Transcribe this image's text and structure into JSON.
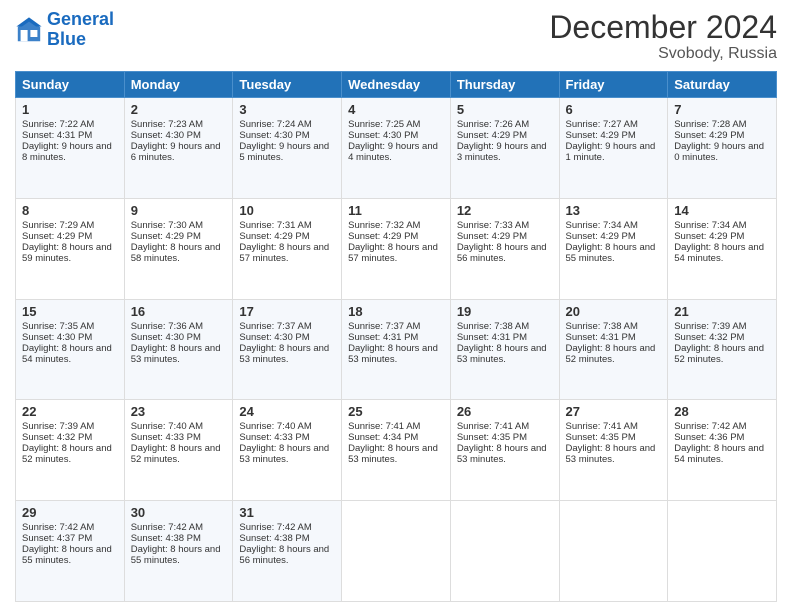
{
  "header": {
    "logo_line1": "General",
    "logo_line2": "Blue",
    "title": "December 2024",
    "subtitle": "Svobody, Russia"
  },
  "weekdays": [
    "Sunday",
    "Monday",
    "Tuesday",
    "Wednesday",
    "Thursday",
    "Friday",
    "Saturday"
  ],
  "weeks": [
    [
      {
        "day": "1",
        "sunrise": "Sunrise: 7:22 AM",
        "sunset": "Sunset: 4:31 PM",
        "daylight": "Daylight: 9 hours and 8 minutes."
      },
      {
        "day": "2",
        "sunrise": "Sunrise: 7:23 AM",
        "sunset": "Sunset: 4:30 PM",
        "daylight": "Daylight: 9 hours and 6 minutes."
      },
      {
        "day": "3",
        "sunrise": "Sunrise: 7:24 AM",
        "sunset": "Sunset: 4:30 PM",
        "daylight": "Daylight: 9 hours and 5 minutes."
      },
      {
        "day": "4",
        "sunrise": "Sunrise: 7:25 AM",
        "sunset": "Sunset: 4:30 PM",
        "daylight": "Daylight: 9 hours and 4 minutes."
      },
      {
        "day": "5",
        "sunrise": "Sunrise: 7:26 AM",
        "sunset": "Sunset: 4:29 PM",
        "daylight": "Daylight: 9 hours and 3 minutes."
      },
      {
        "day": "6",
        "sunrise": "Sunrise: 7:27 AM",
        "sunset": "Sunset: 4:29 PM",
        "daylight": "Daylight: 9 hours and 1 minute."
      },
      {
        "day": "7",
        "sunrise": "Sunrise: 7:28 AM",
        "sunset": "Sunset: 4:29 PM",
        "daylight": "Daylight: 9 hours and 0 minutes."
      }
    ],
    [
      {
        "day": "8",
        "sunrise": "Sunrise: 7:29 AM",
        "sunset": "Sunset: 4:29 PM",
        "daylight": "Daylight: 8 hours and 59 minutes."
      },
      {
        "day": "9",
        "sunrise": "Sunrise: 7:30 AM",
        "sunset": "Sunset: 4:29 PM",
        "daylight": "Daylight: 8 hours and 58 minutes."
      },
      {
        "day": "10",
        "sunrise": "Sunrise: 7:31 AM",
        "sunset": "Sunset: 4:29 PM",
        "daylight": "Daylight: 8 hours and 57 minutes."
      },
      {
        "day": "11",
        "sunrise": "Sunrise: 7:32 AM",
        "sunset": "Sunset: 4:29 PM",
        "daylight": "Daylight: 8 hours and 57 minutes."
      },
      {
        "day": "12",
        "sunrise": "Sunrise: 7:33 AM",
        "sunset": "Sunset: 4:29 PM",
        "daylight": "Daylight: 8 hours and 56 minutes."
      },
      {
        "day": "13",
        "sunrise": "Sunrise: 7:34 AM",
        "sunset": "Sunset: 4:29 PM",
        "daylight": "Daylight: 8 hours and 55 minutes."
      },
      {
        "day": "14",
        "sunrise": "Sunrise: 7:34 AM",
        "sunset": "Sunset: 4:29 PM",
        "daylight": "Daylight: 8 hours and 54 minutes."
      }
    ],
    [
      {
        "day": "15",
        "sunrise": "Sunrise: 7:35 AM",
        "sunset": "Sunset: 4:30 PM",
        "daylight": "Daylight: 8 hours and 54 minutes."
      },
      {
        "day": "16",
        "sunrise": "Sunrise: 7:36 AM",
        "sunset": "Sunset: 4:30 PM",
        "daylight": "Daylight: 8 hours and 53 minutes."
      },
      {
        "day": "17",
        "sunrise": "Sunrise: 7:37 AM",
        "sunset": "Sunset: 4:30 PM",
        "daylight": "Daylight: 8 hours and 53 minutes."
      },
      {
        "day": "18",
        "sunrise": "Sunrise: 7:37 AM",
        "sunset": "Sunset: 4:31 PM",
        "daylight": "Daylight: 8 hours and 53 minutes."
      },
      {
        "day": "19",
        "sunrise": "Sunrise: 7:38 AM",
        "sunset": "Sunset: 4:31 PM",
        "daylight": "Daylight: 8 hours and 53 minutes."
      },
      {
        "day": "20",
        "sunrise": "Sunrise: 7:38 AM",
        "sunset": "Sunset: 4:31 PM",
        "daylight": "Daylight: 8 hours and 52 minutes."
      },
      {
        "day": "21",
        "sunrise": "Sunrise: 7:39 AM",
        "sunset": "Sunset: 4:32 PM",
        "daylight": "Daylight: 8 hours and 52 minutes."
      }
    ],
    [
      {
        "day": "22",
        "sunrise": "Sunrise: 7:39 AM",
        "sunset": "Sunset: 4:32 PM",
        "daylight": "Daylight: 8 hours and 52 minutes."
      },
      {
        "day": "23",
        "sunrise": "Sunrise: 7:40 AM",
        "sunset": "Sunset: 4:33 PM",
        "daylight": "Daylight: 8 hours and 52 minutes."
      },
      {
        "day": "24",
        "sunrise": "Sunrise: 7:40 AM",
        "sunset": "Sunset: 4:33 PM",
        "daylight": "Daylight: 8 hours and 53 minutes."
      },
      {
        "day": "25",
        "sunrise": "Sunrise: 7:41 AM",
        "sunset": "Sunset: 4:34 PM",
        "daylight": "Daylight: 8 hours and 53 minutes."
      },
      {
        "day": "26",
        "sunrise": "Sunrise: 7:41 AM",
        "sunset": "Sunset: 4:35 PM",
        "daylight": "Daylight: 8 hours and 53 minutes."
      },
      {
        "day": "27",
        "sunrise": "Sunrise: 7:41 AM",
        "sunset": "Sunset: 4:35 PM",
        "daylight": "Daylight: 8 hours and 53 minutes."
      },
      {
        "day": "28",
        "sunrise": "Sunrise: 7:42 AM",
        "sunset": "Sunset: 4:36 PM",
        "daylight": "Daylight: 8 hours and 54 minutes."
      }
    ],
    [
      {
        "day": "29",
        "sunrise": "Sunrise: 7:42 AM",
        "sunset": "Sunset: 4:37 PM",
        "daylight": "Daylight: 8 hours and 55 minutes."
      },
      {
        "day": "30",
        "sunrise": "Sunrise: 7:42 AM",
        "sunset": "Sunset: 4:38 PM",
        "daylight": "Daylight: 8 hours and 55 minutes."
      },
      {
        "day": "31",
        "sunrise": "Sunrise: 7:42 AM",
        "sunset": "Sunset: 4:38 PM",
        "daylight": "Daylight: 8 hours and 56 minutes."
      },
      null,
      null,
      null,
      null
    ]
  ]
}
